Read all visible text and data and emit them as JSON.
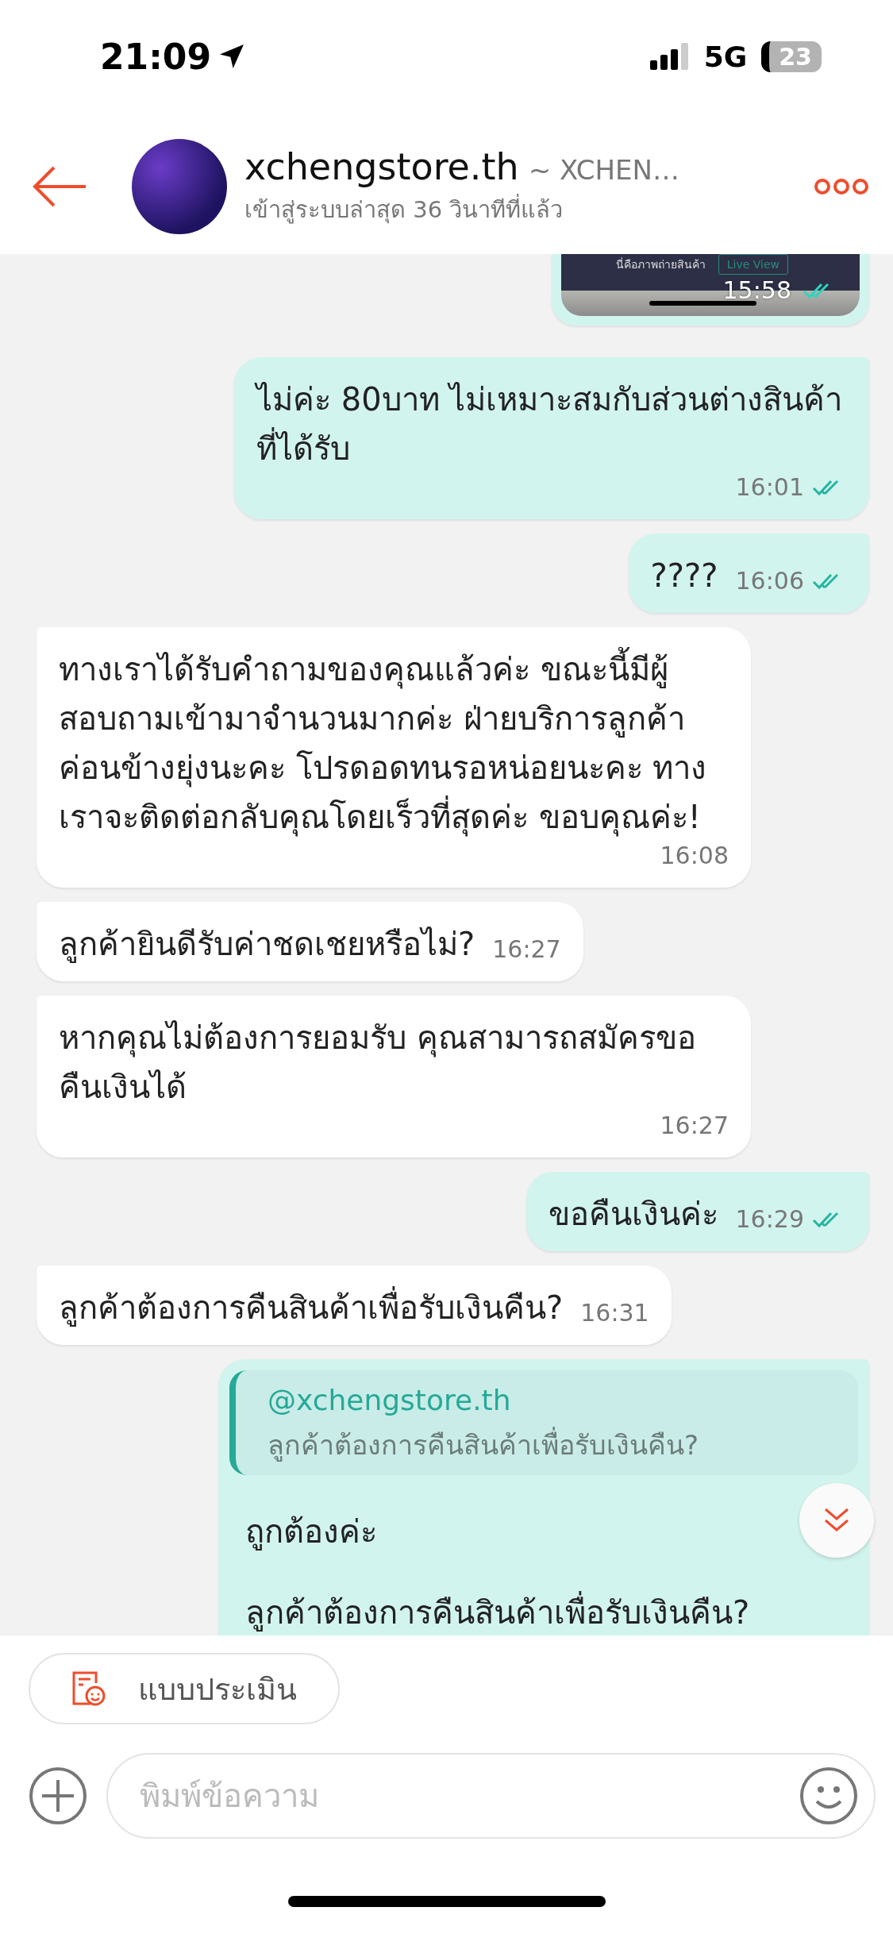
{
  "status_bar": {
    "time": "21:09",
    "network": "5G",
    "battery": "23"
  },
  "header": {
    "name": "xchengstore.th",
    "subtitle": "~ XCHEN…",
    "last_seen": "เข้าสู่ระบบล่าสุด 36 วินาทีที่แล้ว"
  },
  "messages": [
    {
      "kind": "image",
      "outgoing": true,
      "caption": "นี่คือภาพถ่ายสินค้า",
      "button": "Live View",
      "time": "15:58",
      "read": true
    },
    {
      "kind": "text",
      "outgoing": true,
      "text": "ไม่ค่ะ 80บาท ไม่เหมาะสมกับส่วนต่างสินค้าที่ได้รับ",
      "time": "16:01",
      "read": true
    },
    {
      "kind": "text",
      "outgoing": true,
      "text": "????",
      "time": "16:06",
      "read": true
    },
    {
      "kind": "text",
      "outgoing": false,
      "text": "ทางเราได้รับคำถามของคุณแล้วค่ะ ขณะนี้มีผู้สอบถามเข้ามาจำนวนมากค่ะ ฝ่ายบริการลูกค้าค่อนข้างยุ่งนะคะ โปรดอดทนรอหน่อยนะคะ ทางเราจะติดต่อกลับคุณโดยเร็วที่สุดค่ะ ขอบคุณค่ะ!",
      "time": "16:08"
    },
    {
      "kind": "text",
      "outgoing": false,
      "text": "ลูกค้ายินดีรับค่าชดเชยหรือไม่?",
      "time": "16:27"
    },
    {
      "kind": "text",
      "outgoing": false,
      "text": "หากคุณไม่ต้องการยอมรับ คุณสามารถสมัครขอคืนเงินได้",
      "time": "16:27"
    },
    {
      "kind": "text",
      "outgoing": true,
      "text": "ขอคืนเงินค่ะ",
      "time": "16:29",
      "read": true
    },
    {
      "kind": "text",
      "outgoing": false,
      "text": "ลูกค้าต้องการคืนสินค้าเพื่อรับเงินคืน?",
      "time": "16:31"
    },
    {
      "kind": "reply",
      "outgoing": true,
      "quote_author": "@xchengstore.th",
      "quote_text": "ลูกค้าต้องการคืนสินค้าเพื่อรับเงินคืน?",
      "paragraphs": [
        "ถูกต้องค่ะ",
        "ลูกค้าต้องการคืนสินค้าเพื่อรับเงินคืน?"
      ]
    }
  ],
  "survey_button": "แบบประเมิน",
  "composer": {
    "placeholder": "พิมพ์ข้อความ"
  }
}
